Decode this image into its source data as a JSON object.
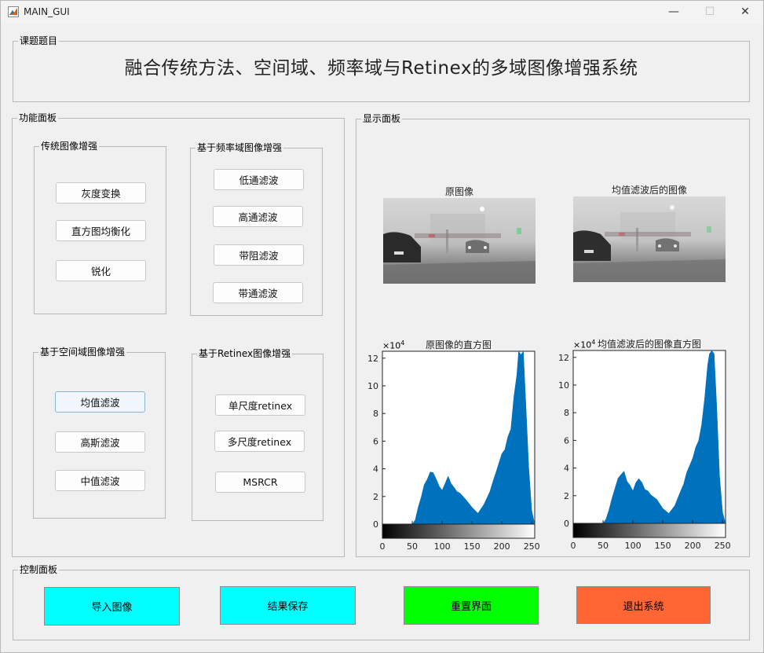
{
  "window": {
    "title": "MAIN_GUI",
    "minimize": "—",
    "maximize": "☐",
    "close": "✕"
  },
  "topic_panel": {
    "title": "课题题目",
    "heading": "融合传统方法、空间域、频率域与Retinex的多域图像增强系统"
  },
  "function_panel": {
    "title": "功能面板",
    "traditional": {
      "title": "传统图像增强",
      "buttons": [
        "灰度变换",
        "直方图均衡化",
        "锐化"
      ]
    },
    "frequency": {
      "title": "基于频率域图像增强",
      "buttons": [
        "低通滤波",
        "高通滤波",
        "带阻滤波",
        "带通滤波"
      ]
    },
    "spatial": {
      "title": "基于空间域图像增强",
      "buttons": [
        "均值滤波",
        "高斯滤波",
        "中值滤波"
      ]
    },
    "retinex": {
      "title": "基于Retinex图像增强",
      "buttons": [
        "单尺度retinex",
        "多尺度retinex",
        "MSRCR"
      ]
    }
  },
  "display_panel": {
    "title": "显示面板",
    "original_title": "原图像",
    "processed_title": "均值滤波后的图像",
    "hist_original_title": "原图像的直方图",
    "hist_processed_title": "均值滤波后的图像直方图",
    "exponent_label": "×10",
    "exponent_power": "4"
  },
  "control_panel": {
    "title": "控制面板",
    "buttons": [
      {
        "label": "导入图像",
        "color": "#00ffff"
      },
      {
        "label": "结果保存",
        "color": "#00ffff"
      },
      {
        "label": "重置界面",
        "color": "#00ff00"
      },
      {
        "label": "退出系统",
        "color": "#ff6633"
      }
    ]
  },
  "chart_data": [
    {
      "type": "area",
      "title": "原图像的直方图",
      "xlabel": "",
      "ylabel": "",
      "x_ticks": [
        0,
        50,
        100,
        150,
        200,
        250
      ],
      "y_ticks": [
        "0",
        "2",
        "4",
        "6",
        "8",
        "10",
        "12"
      ],
      "y_scale_label": "×10^4",
      "xlim": [
        0,
        255
      ],
      "ylim": [
        0,
        125000
      ],
      "color": "#0072bd",
      "x": [
        0,
        20,
        30,
        40,
        50,
        55,
        60,
        65,
        70,
        75,
        80,
        85,
        90,
        95,
        100,
        105,
        110,
        115,
        120,
        125,
        130,
        140,
        150,
        160,
        170,
        180,
        185,
        190,
        200,
        205,
        210,
        215,
        220,
        225,
        228,
        232,
        236,
        240,
        245,
        250,
        255
      ],
      "values": [
        0,
        0,
        0,
        0,
        0,
        3000,
        12000,
        20000,
        28000,
        33000,
        37000,
        38000,
        32000,
        28000,
        24000,
        30000,
        34000,
        30000,
        26000,
        24000,
        22000,
        18000,
        12000,
        8000,
        14000,
        24000,
        30000,
        38000,
        50000,
        55000,
        62000,
        70000,
        90000,
        110000,
        125000,
        125000,
        125000,
        90000,
        40000,
        10000,
        0
      ]
    },
    {
      "type": "area",
      "title": "均值滤波后的图像直方图",
      "xlabel": "",
      "ylabel": "",
      "x_ticks": [
        0,
        50,
        100,
        150,
        200,
        250
      ],
      "y_ticks": [
        "0",
        "2",
        "4",
        "6",
        "8",
        "10",
        "12"
      ],
      "y_scale_label": "×10^4",
      "xlim": [
        0,
        255
      ],
      "ylim": [
        0,
        125000
      ],
      "color": "#0072bd",
      "x": [
        0,
        20,
        40,
        50,
        55,
        60,
        65,
        70,
        75,
        80,
        85,
        90,
        95,
        100,
        105,
        110,
        115,
        120,
        125,
        130,
        140,
        150,
        160,
        170,
        180,
        185,
        190,
        200,
        205,
        210,
        215,
        220,
        225,
        228,
        232,
        236,
        240,
        245,
        250,
        255
      ],
      "values": [
        0,
        0,
        0,
        0,
        3000,
        10000,
        18000,
        26000,
        32000,
        36000,
        37000,
        31000,
        27000,
        24000,
        29000,
        33000,
        29000,
        25000,
        23000,
        21000,
        17000,
        11000,
        7000,
        13000,
        23000,
        29000,
        36000,
        48000,
        54000,
        61000,
        70000,
        92000,
        112000,
        125000,
        125000,
        125000,
        85000,
        35000,
        8000,
        0
      ]
    }
  ]
}
